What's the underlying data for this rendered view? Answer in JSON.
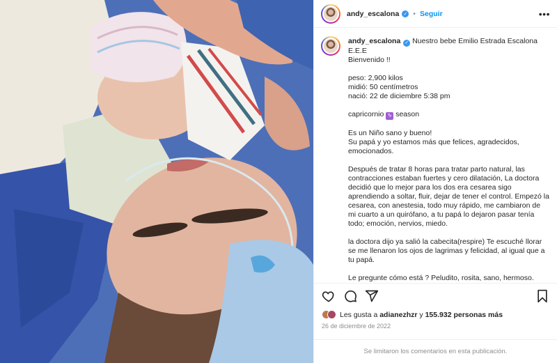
{
  "post": {
    "username": "andy_escalona",
    "follow_label": "Seguir",
    "more_label": "•••",
    "caption_lines": [
      "Nuestro bebe Emilio Estrada Escalona E.E.E",
      "Bienvenido !!",
      "",
      "peso: 2,900 kilos",
      "midió: 50 centímetros",
      "nació: 22 de diciembre 5:38 pm",
      "",
      "capricornio",
      "",
      "Es un Niño sano y bueno!",
      "Su papá y yo estamos más que felices, agradecidos, emocionados.",
      "",
      "Después de tratar 8 horas para tratar parto natural, las contracciones estaban fuertes y cero dilatación, La doctora decidió que lo mejor para los dos era cesarea sigo aprendiendo a soltar, fluir, dejar de tener el control. Empezó la cesarea, con anestesia, todo muy rápido, me cambiaron de mi cuarto a un quirófano, a tu papá lo dejaron pasar tenía todo; emoción, nervios, miedo.",
      "",
      "la doctora dijo ya salió la cabecita(respire) Te escuché llorar se me llenaron los ojos de lagrimas y felicidad, al igual que a tu papá.",
      "",
      "Le pregunte cómo está ? Peludito, rosita, sano, hermoso. Cuando te vi por primera vez, te pusieron en mi pecho, jamás había sentido algo así. No encuentro palabras para describirlo"
    ],
    "zodiac_suffix": "season",
    "zodiac_symbol": "♑",
    "likes_prefix": "Les gusta a ",
    "likes_user": "adianezhzr",
    "likes_middle": " y ",
    "likes_count": "155.932 personas más",
    "date": "26 de diciembre de 2022",
    "comments_disabled": "Se limitaron los comentarios en esta publicación."
  },
  "icons": {
    "verified": "verified-badge-icon",
    "like": "heart-icon",
    "comment": "comment-icon",
    "share": "share-icon",
    "save": "bookmark-icon"
  }
}
